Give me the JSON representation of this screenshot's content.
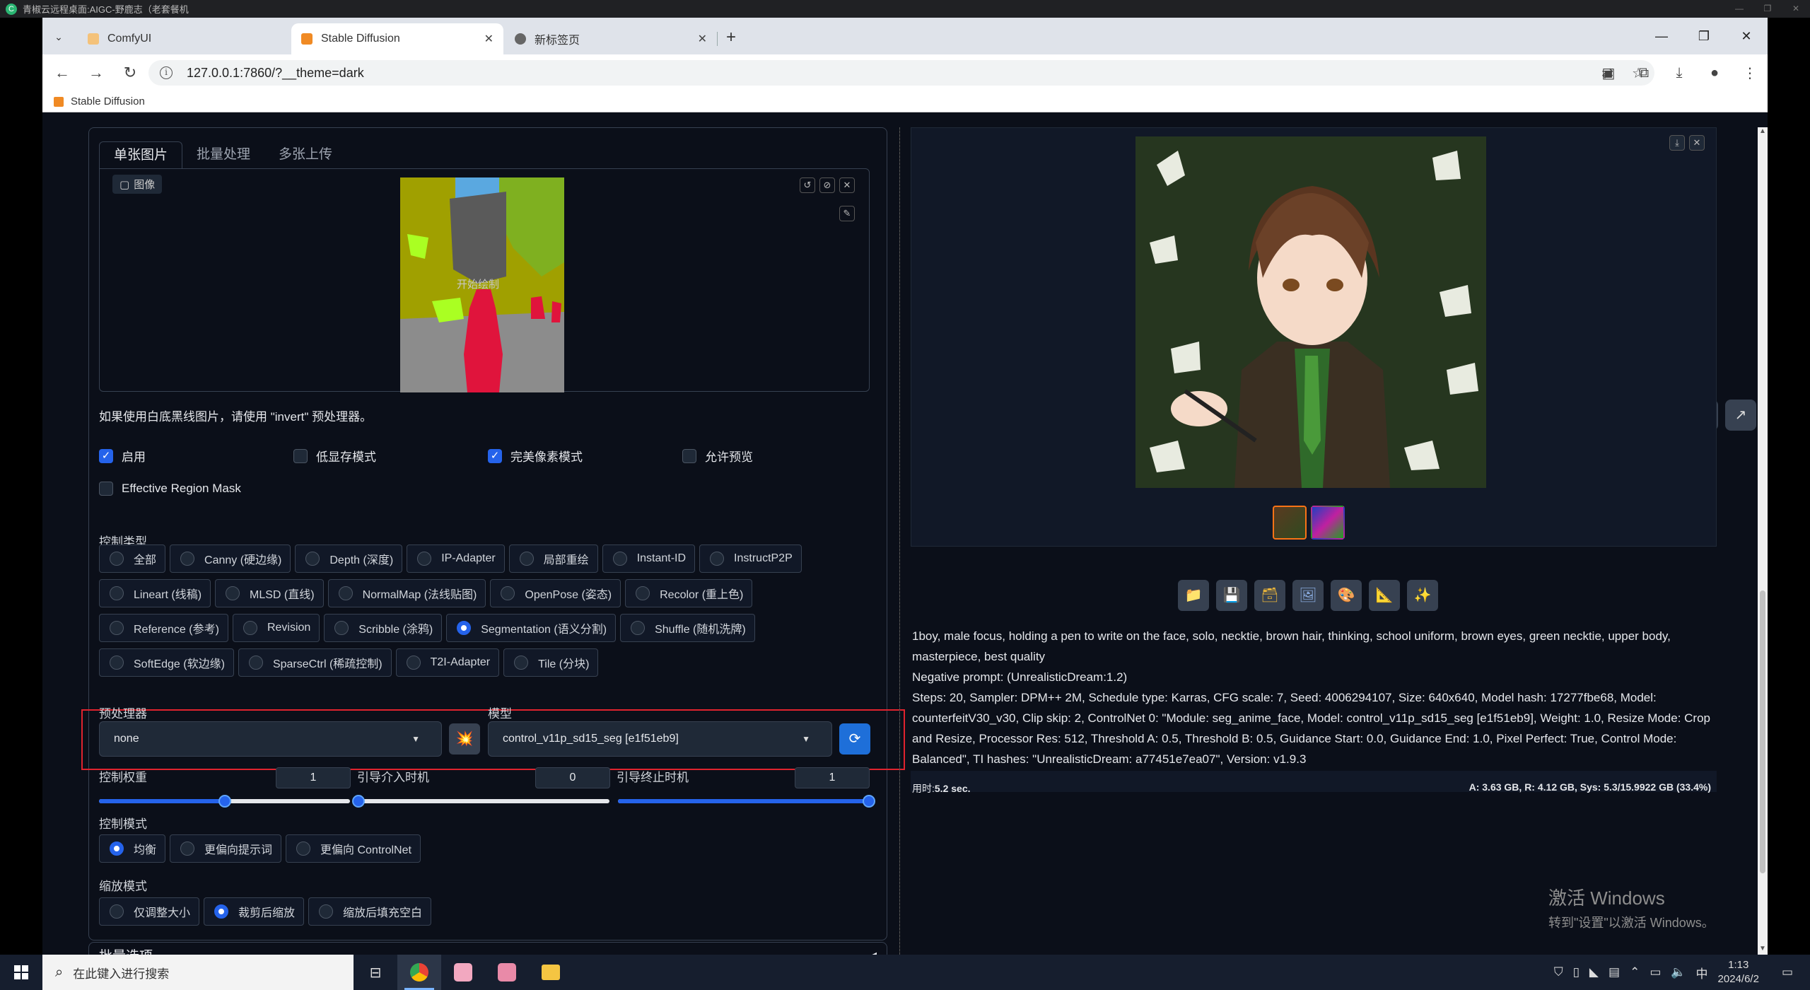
{
  "remote_title": "青椒云远程桌面:AIGC-野鹿志（老套餐机",
  "browser": {
    "tabs": [
      {
        "label": "ComfyUI",
        "state": "inactive"
      },
      {
        "label": "Stable Diffusion",
        "state": "active"
      },
      {
        "label": "新标签页",
        "state": "inactive"
      }
    ],
    "url": "127.0.0.1:7860/?__theme=dark",
    "bookmark": "Stable Diffusion"
  },
  "img_tabs": [
    "单张图片",
    "批量处理",
    "多张上传"
  ],
  "image_label": "图像",
  "canvas_text": "开始绘制",
  "hint": "如果使用白底黑线图片，请使用 \"invert\" 预处理器。",
  "checkboxes": {
    "enable": {
      "label": "启用",
      "checked": true
    },
    "lowvram": {
      "label": "低显存模式",
      "checked": false
    },
    "pixel_perfect": {
      "label": "完美像素模式",
      "checked": true
    },
    "allow_preview": {
      "label": "允许预览",
      "checked": false
    },
    "region_mask": {
      "label": "Effective Region Mask",
      "checked": false
    }
  },
  "control_type_label": "控制类型",
  "control_types": [
    [
      "全部",
      "Canny (硬边缘)",
      "Depth (深度)",
      "IP-Adapter",
      "局部重绘",
      "Instant-ID",
      "InstructP2P"
    ],
    [
      "Lineart (线稿)",
      "MLSD (直线)",
      "NormalMap (法线贴图)",
      "OpenPose (姿态)",
      "Recolor (重上色)"
    ],
    [
      "Reference (参考)",
      "Revision",
      "Scribble (涂鸦)",
      "Segmentation (语义分割)",
      "Shuffle (随机洗牌)"
    ],
    [
      "SoftEdge (软边缘)",
      "SparseCtrl (稀疏控制)",
      "T2I-Adapter",
      "Tile (分块)"
    ]
  ],
  "selected_control_type": "Segmentation (语义分割)",
  "preprocessor_label": "预处理器",
  "preprocessor_value": "none",
  "model_label": "模型",
  "model_value": "control_v11p_sd15_seg [e1f51eb9]",
  "sliders": [
    {
      "label": "控制权重",
      "value": "1",
      "fraction": 0.5
    },
    {
      "label": "引导介入时机",
      "value": "0",
      "fraction": 0.0
    },
    {
      "label": "引导终止时机",
      "value": "1",
      "fraction": 1.0
    }
  ],
  "control_mode_label": "控制模式",
  "control_modes": [
    "均衡",
    "更偏向提示词",
    "更偏向 ControlNet"
  ],
  "selected_control_mode": "均衡",
  "resize_mode_label": "缩放模式",
  "resize_modes": [
    "仅调整大小",
    "裁剪后缩放",
    "缩放后填充空白"
  ],
  "selected_resize_mode": "裁剪后缩放",
  "batch_options": "批量选项",
  "gen_info": {
    "prompt": "1boy, male focus, holding a pen to write on the face, solo, necktie, brown hair, thinking, school uniform, brown eyes, green necktie, upper body, masterpiece, best quality",
    "negative": "Negative prompt: (UnrealisticDream:1.2)",
    "params": "Steps: 20, Sampler: DPM++ 2M, Schedule type: Karras, CFG scale: 7, Seed: 4006294107, Size: 640x640, Model hash: 17277fbe68, Model: counterfeitV30_v30, Clip skip: 2, ControlNet 0: \"Module: seg_anime_face, Model: control_v11p_sd15_seg [e1f51eb9], Weight: 1.0, Resize Mode: Crop and Resize, Processor Res: 512, Threshold A: 0.5, Threshold B: 0.5, Guidance Start: 0.0, Guidance End: 1.0, Pixel Perfect: True, Control Mode: Balanced\", TI hashes: \"UnrealisticDream: a77451e7ea07\", Version: v1.9.3"
  },
  "time_label": "用时:",
  "time_value": "5.2 sec.",
  "memory": "A: 3.63 GB, R: 4.12 GB, Sys: 5.3/15.9922 GB (33.4%)",
  "watermark": {
    "line1": "激活 Windows",
    "line2": "转到\"设置\"以激活 Windows。"
  },
  "taskbar": {
    "search_placeholder": "在此键入进行搜索",
    "time": "1:13",
    "date": "2024/6/2",
    "ime": "中"
  },
  "colors": {
    "accent": "#2563eb",
    "highlight_box": "#e0232e",
    "bg": "#0b0f19"
  }
}
